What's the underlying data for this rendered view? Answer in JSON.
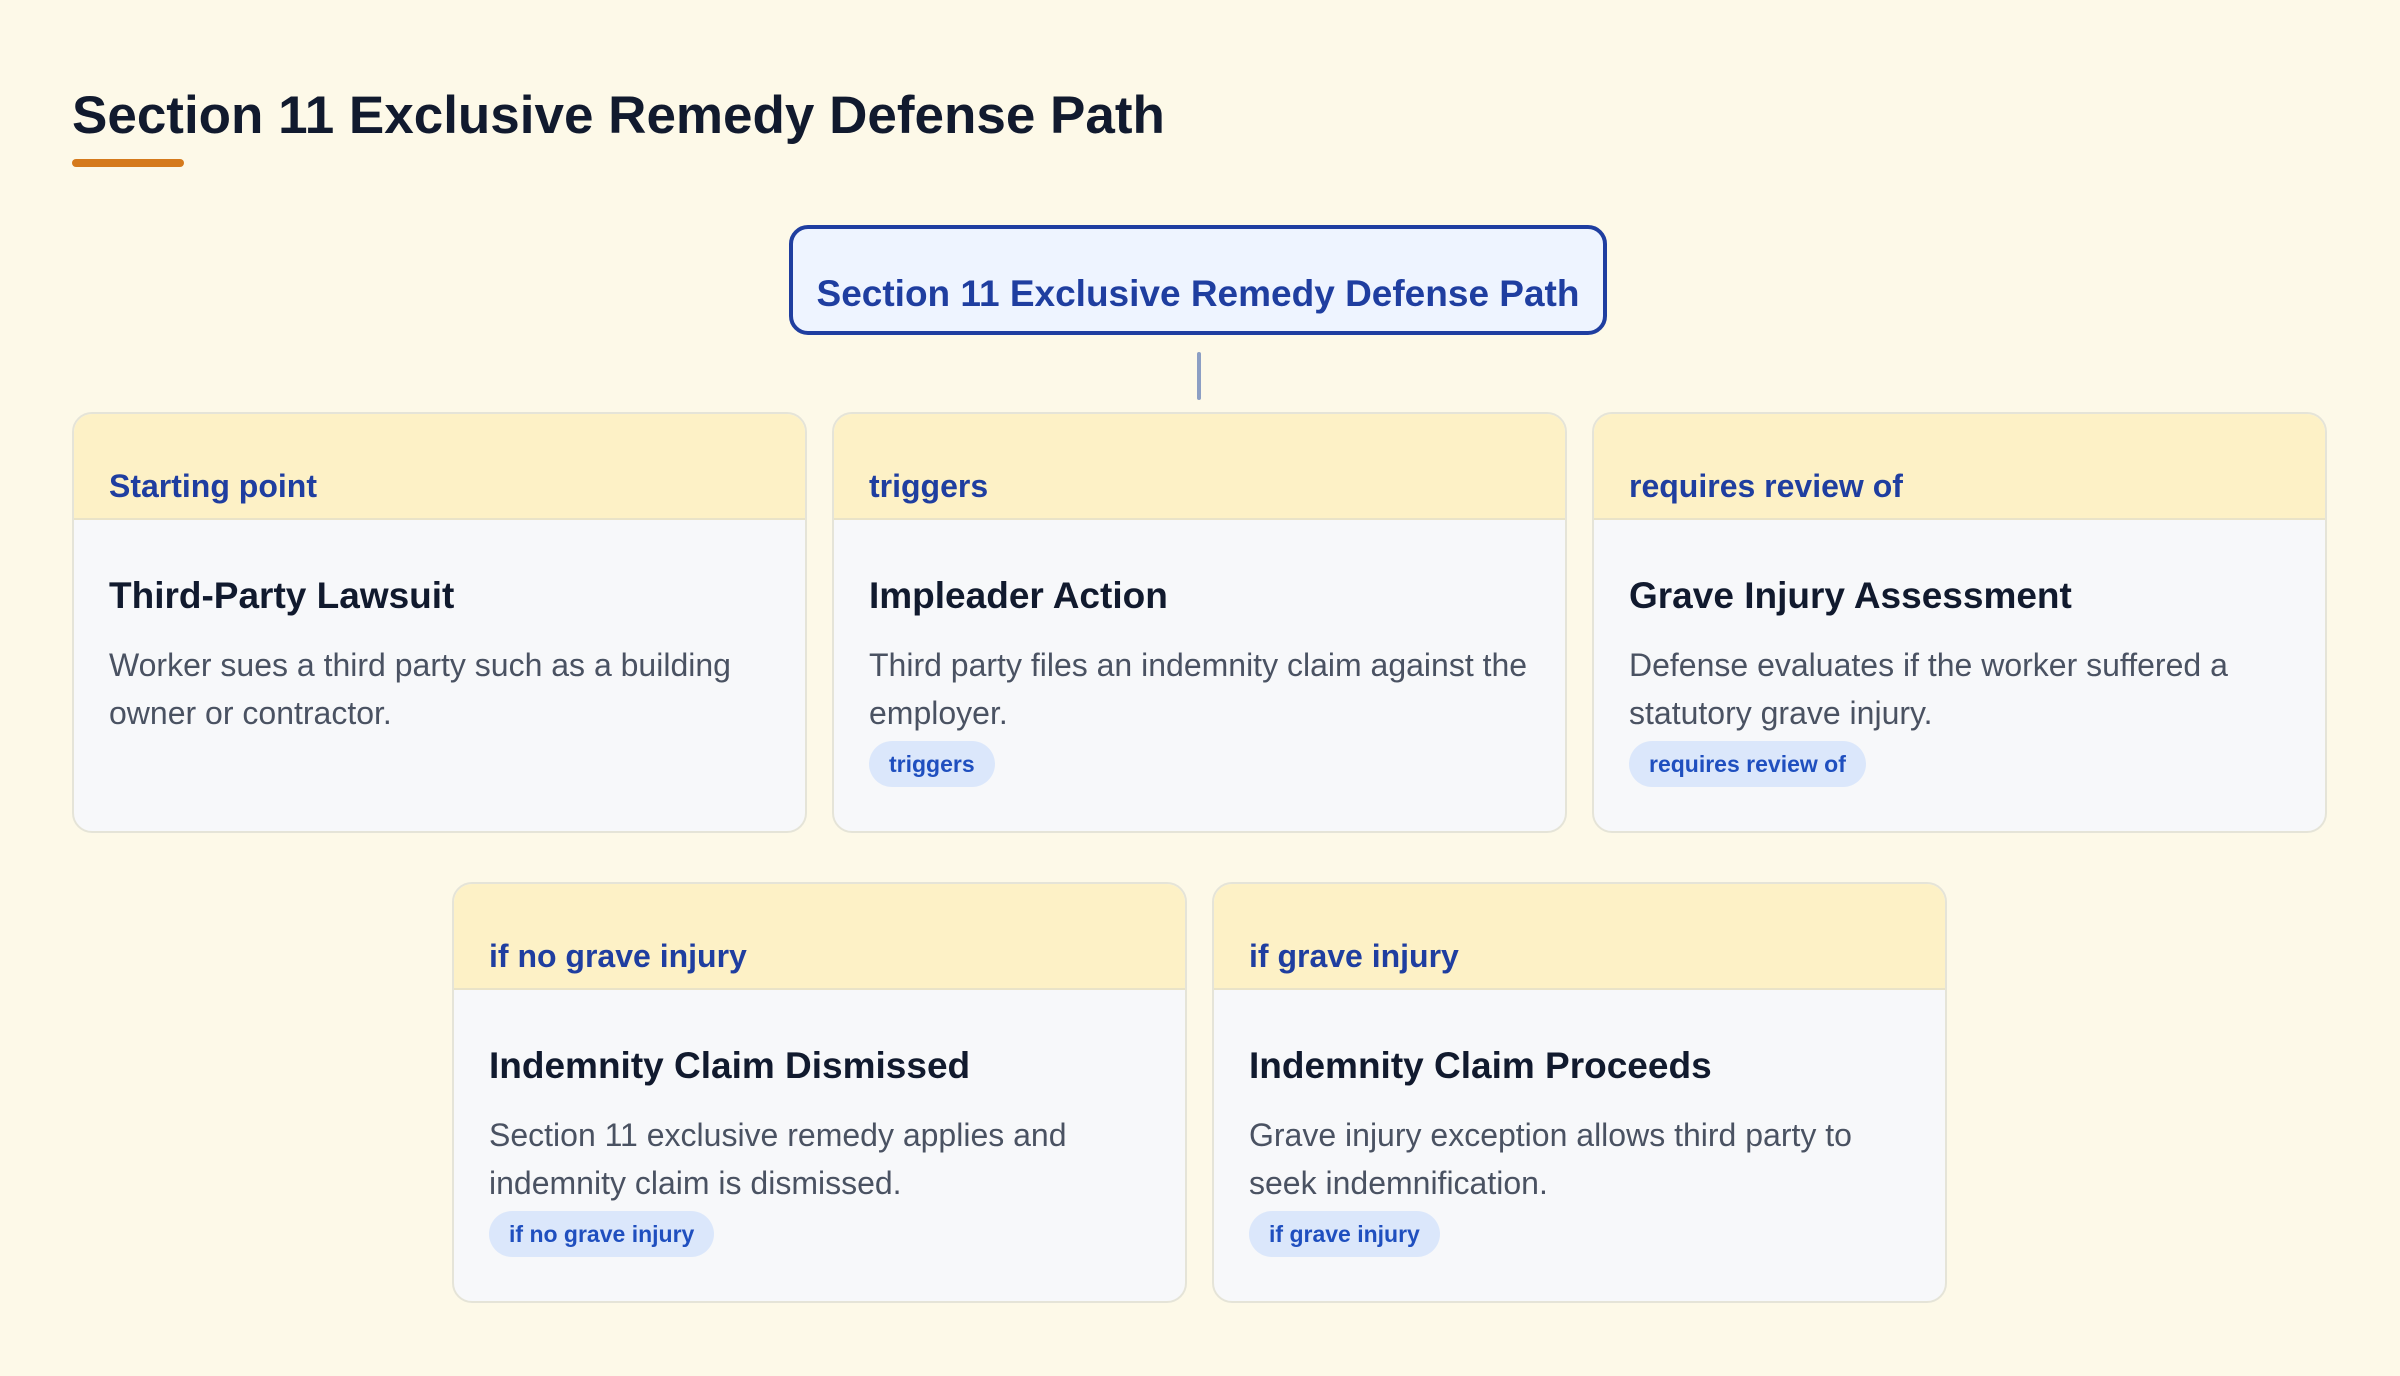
{
  "page": {
    "title": "Section 11 Exclusive Remedy Defense Path"
  },
  "root": {
    "label": "Section 11 Exclusive Remedy Defense Path"
  },
  "nodes": [
    {
      "relation": "Starting point",
      "title": "Third-Party Lawsuit",
      "description": "Worker sues a third party such as a building owner or contractor.",
      "badge": ""
    },
    {
      "relation": "triggers",
      "title": "Impleader Action",
      "description": "Third party files an indemnity claim against the employer.",
      "badge": "triggers"
    },
    {
      "relation": "requires review of",
      "title": "Grave Injury Assessment",
      "description": "Defense evaluates if the worker suffered a statutory grave injury.",
      "badge": "requires review of"
    },
    {
      "relation": "if no grave injury",
      "title": "Indemnity Claim Dismissed",
      "description": "Section 11 exclusive remedy applies and indemnity claim is dismissed.",
      "badge": "if no grave injury"
    },
    {
      "relation": "if grave injury",
      "title": "Indemnity Claim Proceeds",
      "description": "Grave injury exception allows third party to seek indemnification.",
      "badge": "if grave injury"
    }
  ],
  "colors": {
    "background": "#fdf9e8",
    "accent": "#d57a1c",
    "primary": "#1f3ea0",
    "card_header": "#fdf1c6",
    "badge": "#dbe7fb"
  }
}
